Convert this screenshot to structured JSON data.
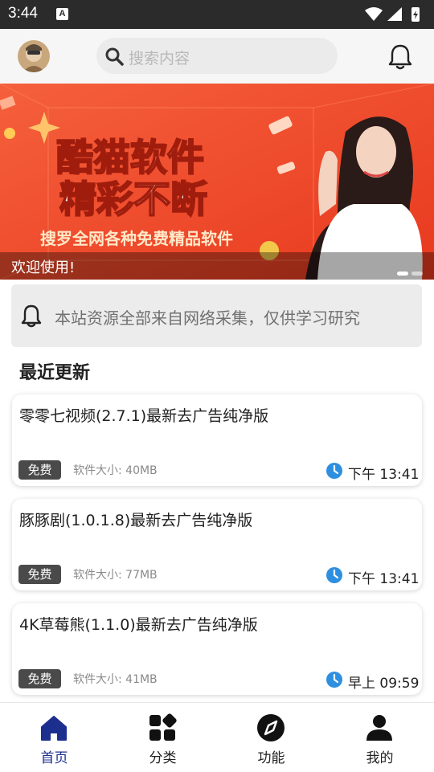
{
  "status_bar": {
    "time": "3:44"
  },
  "header": {
    "search_placeholder": "搜索内容"
  },
  "banner": {
    "headline_line1": "酷猫软件",
    "headline_line2": "精彩不断",
    "tagline": "搜罗全网各种免费精品软件",
    "caption": "欢迎使用!"
  },
  "notice": {
    "text": "本站资源全部来自网络采集，仅供学习研究"
  },
  "section_title": "最近更新",
  "items": [
    {
      "title": "零零七视频(2.7.1)最新去广告纯净版",
      "badge": "免费",
      "size": "软件大小: 40MB",
      "time": "下午 13:41"
    },
    {
      "title": "豚豚剧(1.0.1.8)最新去广告纯净版",
      "badge": "免费",
      "size": "软件大小: 77MB",
      "time": "下午 13:41"
    },
    {
      "title": "4K草莓熊(1.1.0)最新去广告纯净版",
      "badge": "免费",
      "size": "软件大小: 41MB",
      "time": "早上 09:59"
    }
  ],
  "nav": [
    {
      "label": "首页",
      "icon": "home-icon"
    },
    {
      "label": "分类",
      "icon": "category-icon"
    },
    {
      "label": "功能",
      "icon": "compass-icon"
    },
    {
      "label": "我的",
      "icon": "person-icon"
    }
  ],
  "colors": {
    "accent": "#1c2f8f",
    "clock": "#2d8fe0",
    "banner": "#f24c2d"
  }
}
